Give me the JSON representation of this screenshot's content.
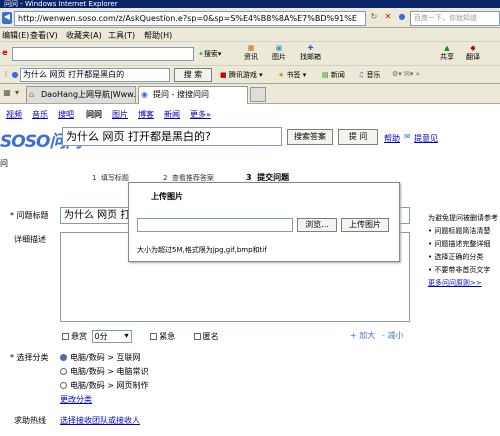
{
  "window": {
    "title": "问问 - Windows Internet Explorer"
  },
  "address": {
    "url": "http://wenwen.soso.com/z/AskQuestion.e?sp=0&sp=S%E4%B8%8A%E7%BD%91%E",
    "search_placeholder": "百度一下，你就知道"
  },
  "menu": [
    "编辑(E)",
    "查看(V)",
    "收藏夹(A)",
    "工具(T)",
    "帮助(H)"
  ],
  "toolbar": {
    "search_button": "搜索",
    "items": [
      "资讯",
      "图片",
      "找邮箱",
      "共享",
      "翻译"
    ]
  },
  "toolbar2": {
    "query_field": "为什么 网页 打开都是黑白的",
    "search_button": "搜 索",
    "items": [
      "腾讯游戏",
      "书签",
      "新闻",
      "音乐"
    ]
  },
  "tabs": [
    {
      "label": "DaoHang上网导航|Www..."
    },
    {
      "label": "提问 - 搜搜问问"
    }
  ],
  "channels": [
    "视频",
    "音乐",
    "搜吧",
    "问问",
    "图片",
    "博客",
    "新闻",
    "更多»"
  ],
  "header": {
    "logo": "SOSO问问",
    "question_value": "为什么 网页 打开都是黑白的?",
    "search_answers_button": "搜索答案",
    "ask_button": "提 问",
    "help_link": "帮助",
    "feedback_link": "提意见"
  },
  "breadcrumb": "问",
  "steps": [
    {
      "num": "1",
      "label": "填写标题"
    },
    {
      "num": "2",
      "label": "查看推荐答案"
    },
    {
      "num": "3",
      "label": "提交问题"
    }
  ],
  "form": {
    "title_label": "* 问题标题",
    "title_value": "为什么 网页 打",
    "desc_label": "详细描述",
    "options": {
      "reward_label": "悬赏",
      "reward_value": "0分",
      "urgent_label": "紧急",
      "anonymous_label": "匿名"
    },
    "add_label": "+ 加大",
    "reduce_label": "- 减小",
    "category_label": "* 选择分类",
    "categories": [
      "电脑/数码 > 互联网",
      "电脑/数码 > 电脑常识",
      "电脑/数码 > 网页制作"
    ],
    "change_category": "更改分类",
    "hotline_label": "求助热线",
    "hotline_link": "选择接收团队或接收人"
  },
  "tips": {
    "items": [
      "为避免提问被删请参考",
      "问题标题简洁清楚",
      "问题描述完整详细",
      "选择正确的分类",
      "不要带非首页文字"
    ],
    "more_link": "更多问问原则>>"
  },
  "upload_dialog": {
    "title": "上传图片",
    "browse_button": "浏览...",
    "upload_button": "上传图片",
    "hint": "大小为超过5M,格式限为jpg,gif,bmp和tif"
  }
}
